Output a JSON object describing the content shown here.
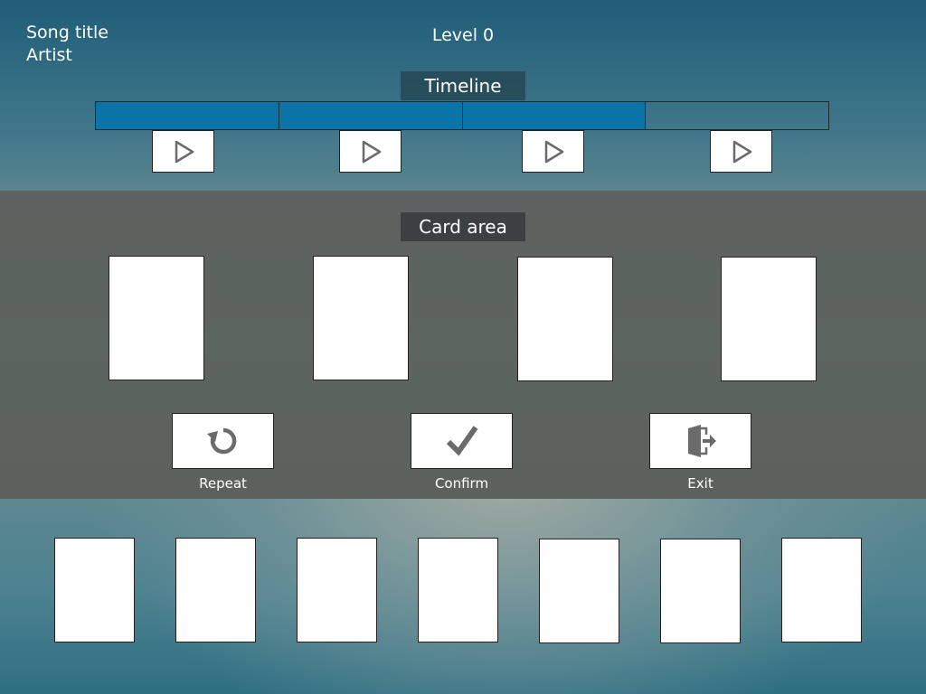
{
  "song": {
    "title": "Song title",
    "artist": "Artist"
  },
  "level": "Level 0",
  "timeline": {
    "title": "Timeline",
    "filled_segments": 3,
    "total_segments": 4,
    "play_icon": "play-icon"
  },
  "card_area": {
    "title": "Card area",
    "slot_count": 4
  },
  "actions": {
    "repeat_label": "Repeat",
    "confirm_label": "Confirm",
    "exit_label": "Exit"
  },
  "hand": {
    "card_count": 7
  },
  "colors": {
    "timeline_fill": "#0a73a8",
    "icon_gray": "#6b6b6b"
  }
}
